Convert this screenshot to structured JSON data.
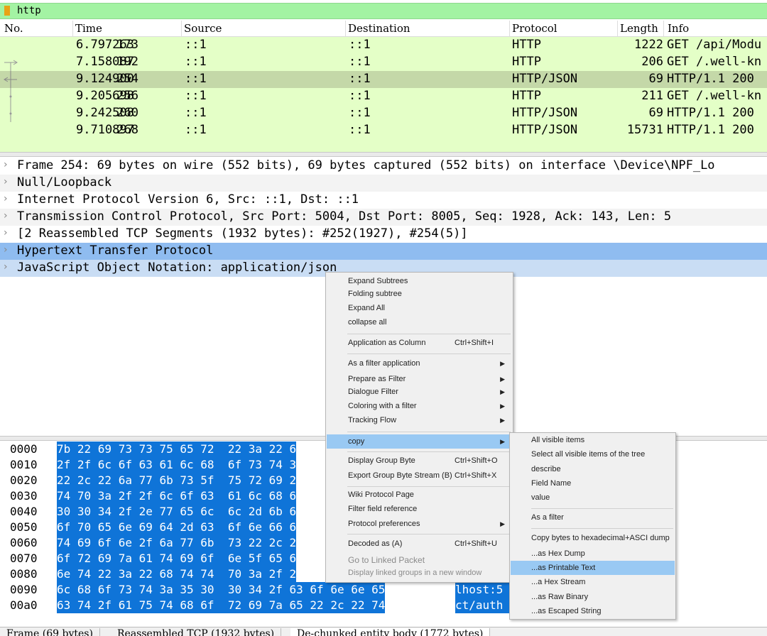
{
  "filter": {
    "text": "http",
    "bookmark_icon": "bookmark-icon"
  },
  "packet_list": {
    "columns": [
      "No.",
      "Time",
      "Source",
      "Destination",
      "Protocol",
      "Length",
      "Info"
    ],
    "rows": [
      {
        "no": "173",
        "time": "6.797263",
        "src": "::1",
        "dst": "::1",
        "proto": "HTTP",
        "len": "1222",
        "info": "GET /api/Modu"
      },
      {
        "no": "192",
        "time": "7.158087",
        "src": "::1",
        "dst": "::1",
        "proto": "HTTP",
        "len": "206",
        "info": "GET /.well-kn"
      },
      {
        "no": "254",
        "time": "9.124900",
        "src": "::1",
        "dst": "::1",
        "proto": "HTTP/JSON",
        "len": "69",
        "info": "HTTP/1.1 200"
      },
      {
        "no": "256",
        "time": "9.205698",
        "src": "::1",
        "dst": "::1",
        "proto": "HTTP",
        "len": "211",
        "info": "GET /.well-kn"
      },
      {
        "no": "260",
        "time": "9.242508",
        "src": "::1",
        "dst": "::1",
        "proto": "HTTP/JSON",
        "len": "69",
        "info": "HTTP/1.1 200"
      },
      {
        "no": "268",
        "time": "9.710897",
        "src": "::1",
        "dst": "::1",
        "proto": "HTTP/JSON",
        "len": "15731",
        "info": "HTTP/1.1 200"
      }
    ],
    "selected_no": "254"
  },
  "details": [
    "Frame 254: 69 bytes on wire (552 bits), 69 bytes captured (552 bits) on interface \\Device\\NPF_Lo",
    "Null/Loopback",
    "Internet Protocol Version 6, Src: ::1, Dst: ::1",
    "Transmission Control Protocol, Src Port: 5004, Dst Port: 8005, Seq: 1928, Ack: 143, Len: 5",
    "[2 Reassembled TCP Segments (1932 bytes): #252(1927), #254(5)]",
    "Hypertext Transfer Protocol",
    "JavaScript Object Notation: application/json"
  ],
  "hex": [
    {
      "off": "0000",
      "hex": "7b 22 69 73 73 75 65 72  22 3a 22 6",
      "asc": ""
    },
    {
      "off": "0010",
      "hex": "2f 2f 6c 6f 63 61 6c 68  6f 73 74 3",
      "asc": ""
    },
    {
      "off": "0020",
      "hex": "22 2c 22 6a 77 6b 73 5f  75 72 69 2",
      "asc": ""
    },
    {
      "off": "0030",
      "hex": "74 70 3a 2f 2f 6c 6f 63  61 6c 68 6",
      "asc": ""
    },
    {
      "off": "0040",
      "hex": "30 30 34 2f 2e 77 65 6c  6c 2d 6b 6",
      "asc": ""
    },
    {
      "off": "0050",
      "hex": "6f 70 65 6e 69 64 2d 63  6f 6e 66 6",
      "asc": ""
    },
    {
      "off": "0060",
      "hex": "74 69 6f 6e 2f 6a 77 6b  73 22 2c 2",
      "asc": ""
    },
    {
      "off": "0070",
      "hex": "6f 72 69 7a 61 74 69 6f  6e 5f 65 6",
      "asc": ""
    },
    {
      "off": "0080",
      "hex": "6e 74 22 3a 22 68 74 74  70 3a 2f 2",
      "asc": ""
    },
    {
      "off": "0090",
      "hex": "6c 68 6f 73 74 3a 35 30  30 34 2f 63 6f 6e 6e 65",
      "asc": "lhost:5"
    },
    {
      "off": "00a0",
      "hex": "63 74 2f 61 75 74 68 6f  72 69 7a 65 22 2c 22 74",
      "asc": "ct/auth"
    }
  ],
  "tabs": [
    "Frame (69 bytes)",
    "Reassembled TCP (1932 bytes)",
    "De-chunked entity body (1772 bytes)"
  ],
  "context_menu": {
    "items": [
      {
        "label": "Expand Subtrees",
        "key": "",
        "submenu": false
      },
      {
        "label": "Folding subtree",
        "key": "",
        "submenu": false
      },
      {
        "label": "Expand All",
        "key": "",
        "submenu": false
      },
      {
        "label": "collapse all",
        "key": "",
        "submenu": false
      },
      {
        "label": "Application as Column",
        "key": "Ctrl+Shift+I",
        "submenu": false
      },
      {
        "label": "As a filter application",
        "key": "",
        "submenu": true
      },
      {
        "label": "Prepare as Filter",
        "key": "",
        "submenu": true
      },
      {
        "label": "Dialogue Filter",
        "key": "",
        "submenu": true
      },
      {
        "label": "Coloring with a filter",
        "key": "",
        "submenu": true
      },
      {
        "label": "Tracking Flow",
        "key": "",
        "submenu": true
      },
      {
        "label": "copy",
        "key": "",
        "submenu": true
      },
      {
        "label": "Display Group Byte",
        "key": "Ctrl+Shift+O",
        "submenu": false
      },
      {
        "label": "Export Group Byte Stream (B)",
        "key": "Ctrl+Shift+X",
        "submenu": false
      },
      {
        "label": "Wiki Protocol Page",
        "key": "",
        "submenu": false
      },
      {
        "label": "Filter field reference",
        "key": "",
        "submenu": false
      },
      {
        "label": "Protocol preferences",
        "key": "",
        "submenu": true
      },
      {
        "label": "Decoded as (A)",
        "key": "Ctrl+Shift+U",
        "submenu": false
      },
      {
        "label": "Go to Linked Packet",
        "key": "",
        "submenu": false
      },
      {
        "label": "Display linked groups in a new window",
        "key": "",
        "submenu": false
      }
    ]
  },
  "copy_submenu": {
    "items": [
      "All visible items",
      "Select all visible items of the tree",
      "describe",
      "Field Name",
      "value",
      "As a filter",
      "Copy bytes to hexadecimal+ASCI dump",
      "...as Hex Dump",
      "...as Printable Text",
      "...a Hex Stream",
      "...as Raw Binary",
      "...as Escaped String"
    ]
  }
}
